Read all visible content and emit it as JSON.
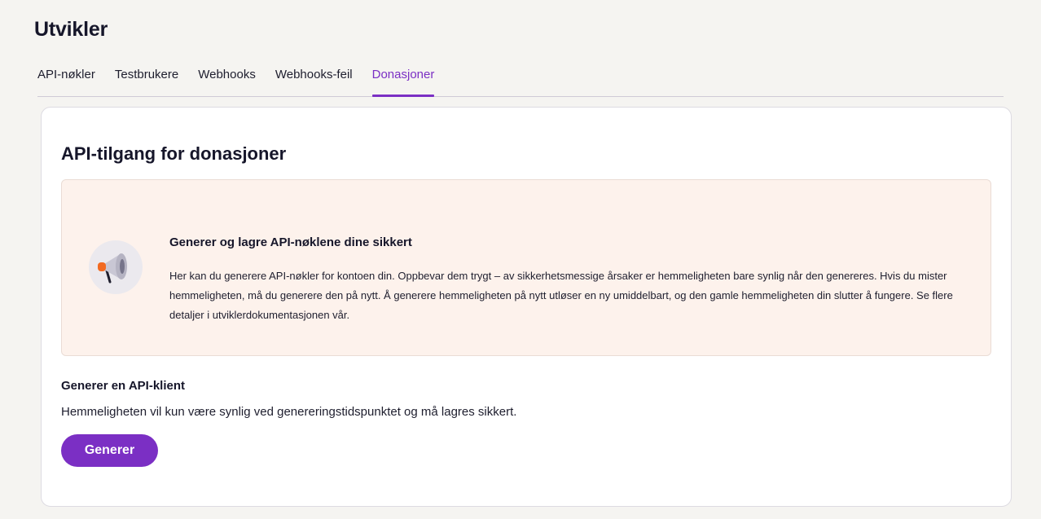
{
  "page": {
    "title": "Utvikler"
  },
  "tabs": [
    {
      "label": "API-nøkler",
      "active": false
    },
    {
      "label": "Testbrukere",
      "active": false
    },
    {
      "label": "Webhooks",
      "active": false
    },
    {
      "label": "Webhooks-feil",
      "active": false
    },
    {
      "label": "Donasjoner",
      "active": true
    }
  ],
  "card": {
    "title": "API-tilgang for donasjoner",
    "callout": {
      "icon": "megaphone-icon",
      "heading": "Generer og lagre API-nøklene dine sikkert",
      "body": "Her kan du generere API-nøkler for kontoen din. Oppbevar dem trygt – av sikkerhetsmessige årsaker er hemmeligheten bare synlig når den genereres. Hvis du mister hemmeligheten, må du generere den på nytt. Å generere hemmeligheten på nytt utløser en ny umiddelbart, og den gamle hemmeligheten din slutter å fungere. Se flere detaljer i utviklerdokumentasjonen vår."
    },
    "section": {
      "heading": "Generer en API-klient",
      "text": "Hemmeligheten vil kun være synlig ved genereringstidspunktet og må lagres sikkert.",
      "button_label": "Generer"
    }
  },
  "colors": {
    "accent": "#7b2fc4",
    "callout_background": "#fdf2ec",
    "page_background": "#f5f4f1"
  }
}
